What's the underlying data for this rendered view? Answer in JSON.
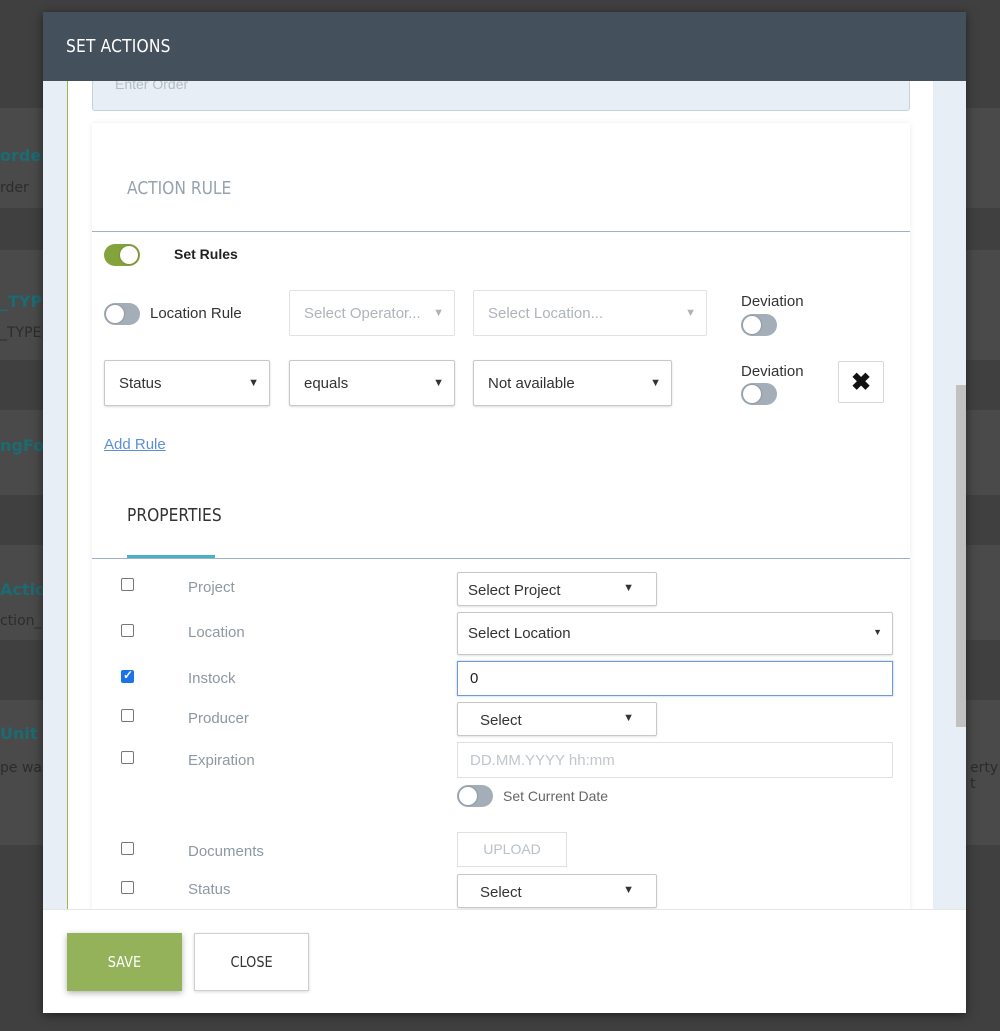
{
  "background": {
    "texts": [
      "order",
      "rder",
      "_TYP",
      "_TYPE",
      "ngFor",
      "Action",
      "ction_",
      "Unit",
      "pe was",
      "erty t"
    ]
  },
  "modal": {
    "title": "SET ACTIONS",
    "order_placeholder": "Enter Order",
    "action_rule": {
      "title": "ACTION RULE",
      "set_rules_label": "Set Rules",
      "set_rules_on": true,
      "location_rule": {
        "label": "Location Rule",
        "enabled": false,
        "operator_placeholder": "Select Operator...",
        "location_placeholder": "Select Location...",
        "deviation_label": "Deviation",
        "deviation_on": false
      },
      "rule": {
        "field": "Status",
        "operator": "equals",
        "value": "Not available",
        "deviation_label": "Deviation",
        "deviation_on": false
      },
      "add_rule_label": "Add Rule"
    },
    "properties": {
      "title": "PROPERTIES",
      "items": [
        {
          "label": "Project",
          "checked": false,
          "control": "Select Project"
        },
        {
          "label": "Location",
          "checked": false,
          "control": "Select Location"
        },
        {
          "label": "Instock",
          "checked": true,
          "control": "0"
        },
        {
          "label": "Producer",
          "checked": false,
          "control": "Select"
        },
        {
          "label": "Expiration",
          "checked": false,
          "control": "DD.MM.YYYY hh:mm"
        },
        {
          "label": "Documents",
          "checked": false,
          "control": "UPLOAD"
        },
        {
          "label": "Status",
          "checked": false,
          "control": "Select"
        }
      ],
      "set_current_date_label": "Set Current Date",
      "set_current_date_on": false
    },
    "footer": {
      "save_label": "SAVE",
      "close_label": "CLOSE"
    }
  },
  "colors": {
    "header": "#44505c",
    "save": "#94b25a",
    "toggle_on": "#85a33c",
    "link": "#5b8fd8",
    "tab_underline": "#4bb0c4"
  }
}
